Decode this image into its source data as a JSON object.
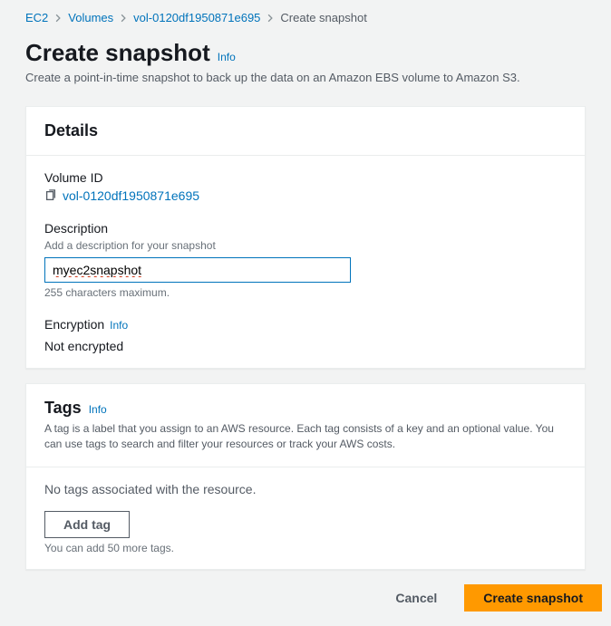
{
  "breadcrumb": {
    "items": [
      {
        "label": "EC2"
      },
      {
        "label": "Volumes"
      },
      {
        "label": "vol-0120df1950871e695"
      }
    ],
    "current": "Create snapshot"
  },
  "page": {
    "title": "Create snapshot",
    "info_label": "Info",
    "subtitle": "Create a point-in-time snapshot to back up the data on an Amazon EBS volume to Amazon S3."
  },
  "details": {
    "heading": "Details",
    "volume_id_label": "Volume ID",
    "volume_id_value": "vol-0120df1950871e695",
    "description_label": "Description",
    "description_sub": "Add a description for your snapshot",
    "description_value": "myec2snapshot",
    "description_hint": "255 characters maximum.",
    "encryption_label": "Encryption",
    "encryption_info": "Info",
    "encryption_value": "Not encrypted"
  },
  "tags": {
    "heading": "Tags",
    "info_label": "Info",
    "description": "A tag is a label that you assign to an AWS resource. Each tag consists of a key and an optional value. You can use tags to search and filter your resources or track your AWS costs.",
    "empty": "No tags associated with the resource.",
    "add_button": "Add tag",
    "hint": "You can add 50 more tags."
  },
  "footer": {
    "cancel": "Cancel",
    "submit": "Create snapshot"
  }
}
